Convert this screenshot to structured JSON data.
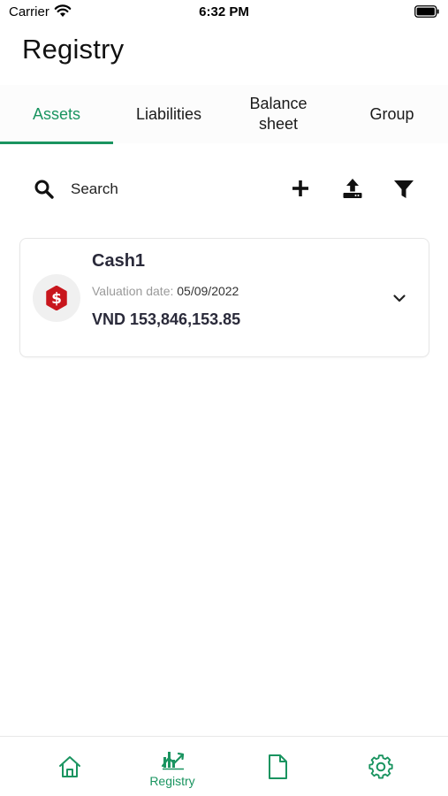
{
  "status_bar": {
    "carrier": "Carrier",
    "time": "6:32 PM",
    "icons": [
      "wifi-icon",
      "battery-icon"
    ]
  },
  "header": {
    "title": "Registry"
  },
  "tabs": [
    {
      "label": "Assets",
      "active": true
    },
    {
      "label": "Liabilities",
      "active": false
    },
    {
      "label": "Balance sheet",
      "active": false
    },
    {
      "label": "Group",
      "active": false
    }
  ],
  "toolbar": {
    "search_label": "Search",
    "icons": [
      "search-icon",
      "add-icon",
      "upload-icon",
      "filter-icon"
    ]
  },
  "assets": [
    {
      "name": "Cash1",
      "valuation_label": "Valuation date:",
      "valuation_date": "05/09/2022",
      "amount": "VND 153,846,153.85",
      "icon": "dollar-icon",
      "icon_color": "#c8161d"
    }
  ],
  "bottom_nav": {
    "items": [
      {
        "icon": "home-icon",
        "label": ""
      },
      {
        "icon": "chart-icon",
        "label": "Registry",
        "active": true
      },
      {
        "icon": "document-icon",
        "label": ""
      },
      {
        "icon": "settings-icon",
        "label": ""
      }
    ]
  },
  "colors": {
    "accent": "#1a9460",
    "asset_icon": "#c8161d",
    "text_primary": "#2a2a3a",
    "text_muted": "#9a9a9a"
  }
}
